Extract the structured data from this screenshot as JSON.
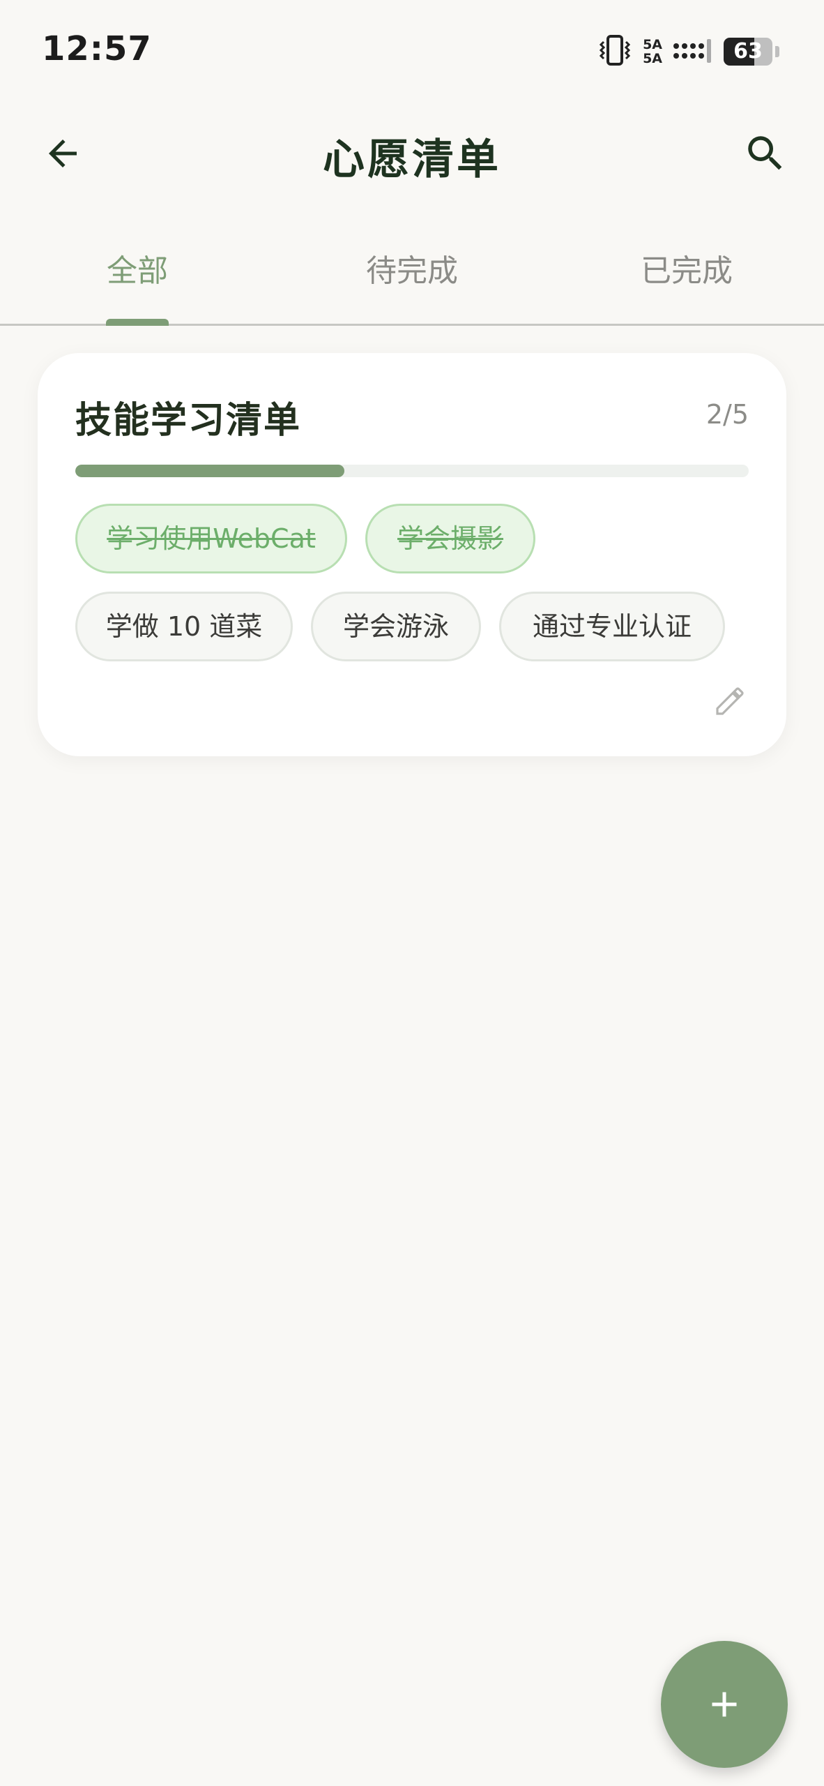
{
  "status_bar": {
    "time": "12:57",
    "network_top": "5A",
    "network_bottom": "5A",
    "battery_level": "63",
    "battery_fraction": 0.63,
    "icons": [
      "vibrate-icon",
      "signal-icon",
      "battery-icon"
    ]
  },
  "app_bar": {
    "title": "心愿清单",
    "back_icon": "arrow-left-icon",
    "search_icon": "search-icon"
  },
  "tabs": [
    {
      "label": "全部",
      "active": true
    },
    {
      "label": "待完成",
      "active": false
    },
    {
      "label": "已完成",
      "active": false
    }
  ],
  "card": {
    "title": "技能学习清单",
    "count": "2/5",
    "progress_fraction": 0.4,
    "items": [
      {
        "label": "学习使用WebCat",
        "done": true
      },
      {
        "label": "学会摄影",
        "done": true
      },
      {
        "label": "学做 10 道菜",
        "done": false
      },
      {
        "label": "学会游泳",
        "done": false
      },
      {
        "label": "通过专业认证",
        "done": false
      }
    ],
    "edit_icon": "pencil-icon"
  },
  "fab": {
    "icon": "plus-icon"
  },
  "colors": {
    "accent": "#7e9d76",
    "background": "#f9f8f5",
    "done_chip_bg": "#e9f6e6",
    "done_chip_text": "#6cae6a"
  }
}
